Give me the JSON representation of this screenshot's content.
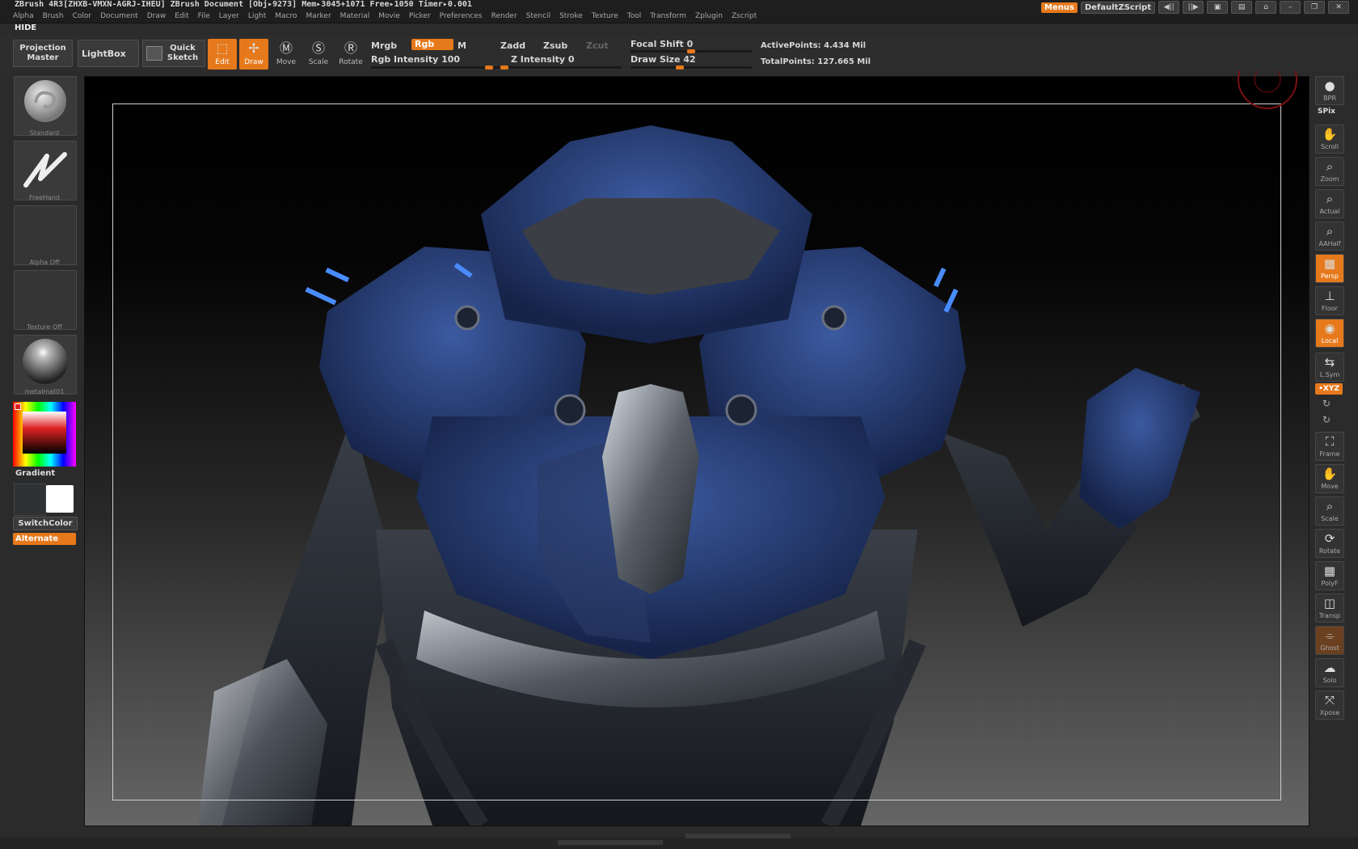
{
  "titlebar": {
    "text": "ZBrush 4R3[ZHXB-VMXN-AGRJ-IHEU]   ZBrush Document   [Obj▸9273] Mem▸3045+1071 Free▸1050 Timer▸0.001"
  },
  "menus": [
    "Alpha",
    "Brush",
    "Color",
    "Document",
    "Draw",
    "Edit",
    "File",
    "Layer",
    "Light",
    "Macro",
    "Marker",
    "Material",
    "Movie",
    "Picker",
    "Preferences",
    "Render",
    "Stencil",
    "Stroke",
    "Texture",
    "Tool",
    "Transform",
    "Zplugin",
    "Zscript"
  ],
  "rightctl": {
    "menus_label": "Menus",
    "script_label": "DefaultZScript"
  },
  "hide_label": "HIDE",
  "toolbar": {
    "projection_master": "Projection Master",
    "lightbox": "LightBox",
    "quick_sketch": "Quick Sketch",
    "edit": "Edit",
    "draw": "Draw",
    "move": "Move",
    "scale": "Scale",
    "rotate": "Rotate",
    "mrgb": "Mrgb",
    "rgb": "Rgb",
    "m": "M",
    "rgb_intensity": "Rgb  Intensity 100",
    "zadd": "Zadd",
    "zsub": "Zsub",
    "zcut": "Zcut",
    "z_intensity": "Z Intensity 0",
    "focal_shift": "Focal Shift 0",
    "draw_size": "Draw Size 42",
    "active_points": "ActivePoints: 4.434  Mil",
    "total_points": "TotalPoints: 127.665  Mil",
    "rgb_intensity_value": 100,
    "z_intensity_value": 0,
    "focal_shift_value": 0,
    "draw_size_value": 42
  },
  "leftpanel": {
    "brush": "Standard",
    "stroke": "FreeHand",
    "alpha": "Alpha  Off",
    "texture": "Texture  Off",
    "material": "metalmat01",
    "gradient": "Gradient",
    "switchcolor": "SwitchColor",
    "alternate": "Alternate"
  },
  "rightpanel": {
    "buttons": [
      {
        "label": "BPR",
        "icon": "bpr-sphere-icon"
      },
      {
        "label": "Scroll",
        "icon": "hand-icon"
      },
      {
        "label": "Zoom",
        "icon": "magnifier-icon"
      },
      {
        "label": "Actual",
        "icon": "magnifier-icon"
      },
      {
        "label": "AAHalf",
        "icon": "magnifier-icon"
      },
      {
        "label": "Persp",
        "icon": "grid-icon"
      },
      {
        "label": "Floor",
        "icon": "floor-icon"
      },
      {
        "label": "Local",
        "icon": "local-icon"
      },
      {
        "label": "L.Sym",
        "icon": "sym-icon"
      },
      {
        "label": "Frame",
        "icon": "frame-icon"
      },
      {
        "label": "Move",
        "icon": "hand-icon"
      },
      {
        "label": "Scale",
        "icon": "magnifier-icon"
      },
      {
        "label": "Rotate",
        "icon": "rotate-icon"
      },
      {
        "label": "PolyF",
        "icon": "grid-icon"
      },
      {
        "label": "Transp",
        "icon": "transp-icon"
      },
      {
        "label": "Ghost",
        "icon": "ghost-icon"
      },
      {
        "label": "Solo",
        "icon": "solo-icon"
      },
      {
        "label": "Xpose",
        "icon": "xpose-icon"
      }
    ],
    "spix": "SPix",
    "xyz": "•XYZ"
  }
}
